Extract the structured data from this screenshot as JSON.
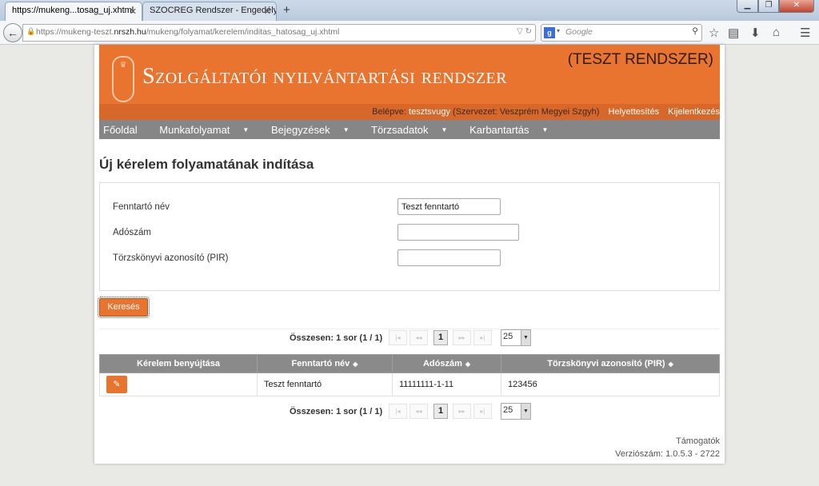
{
  "browser": {
    "tabs": [
      {
        "title": "https://mukeng...tosag_uj.xhtml",
        "active": true
      },
      {
        "title": "SZOCREG Rendszer - Engedély ...",
        "active": false
      }
    ],
    "new_tab": "+",
    "url_prefix": "https://mukeng-teszt.",
    "url_domain": "nrszh.hu",
    "url_path": "/mukeng/folyamat/kerelem/inditas_hatosag_uj.xhtml",
    "search_placeholder": "Google",
    "window_controls": [
      "minimize-icon",
      "maximize-icon",
      "close-icon"
    ],
    "toolbar_icons": [
      "bookmark-star-icon",
      "reading-list-icon",
      "download-icon",
      "home-icon",
      "menu-icon"
    ]
  },
  "header": {
    "title": "Szolgáltatói nyilvántartási rendszer",
    "badge": "(TESZT RENDSZER)",
    "login_label": "Belépve:",
    "username": "tesztsvugy",
    "organization": "(Szervezet: Veszprém Megyei Szgyh)",
    "links": [
      "Helyettesítés",
      "Kijelentkezés"
    ]
  },
  "menu": [
    {
      "label": "Főoldal",
      "dropdown": false
    },
    {
      "label": "Munkafolyamat",
      "dropdown": true
    },
    {
      "label": "Bejegyzések",
      "dropdown": true
    },
    {
      "label": "Törzsadatok",
      "dropdown": true
    },
    {
      "label": "Karbantartás",
      "dropdown": true
    }
  ],
  "page_title": "Új kérelem folyamatának indítása",
  "form": {
    "fields": [
      {
        "label": "Fenntartó név",
        "value": ""
      },
      {
        "label": "Adószám",
        "value": ""
      },
      {
        "label": "Törzskönyvi azonosító (PIR)",
        "value": ""
      }
    ],
    "fenntarto_value": "Teszt fenntartó",
    "search_button": "Keresés"
  },
  "pager": {
    "summary": "Összesen: 1 sor (1 / 1)",
    "current_page": "1",
    "page_size": "25",
    "nav_icons": [
      "first-page-icon",
      "prev-page-icon",
      "next-page-icon",
      "last-page-icon"
    ]
  },
  "table": {
    "headers": [
      "Kérelem benyújtása",
      "Fenntartó név",
      "Adószám",
      "Törzskönyvi azonosító (PIR)"
    ],
    "rows": [
      {
        "fenntarto": "Teszt fenntartó",
        "adoszam": "11111111-1-11",
        "pir": "123456"
      }
    ]
  },
  "footer": {
    "support": "Támogatók",
    "version": "Verziószám: 1.0.5.3 - 2722"
  },
  "colors": {
    "brand": "#e8742f",
    "menu_bg": "#868686",
    "grid_header": "#8a8a8a"
  }
}
